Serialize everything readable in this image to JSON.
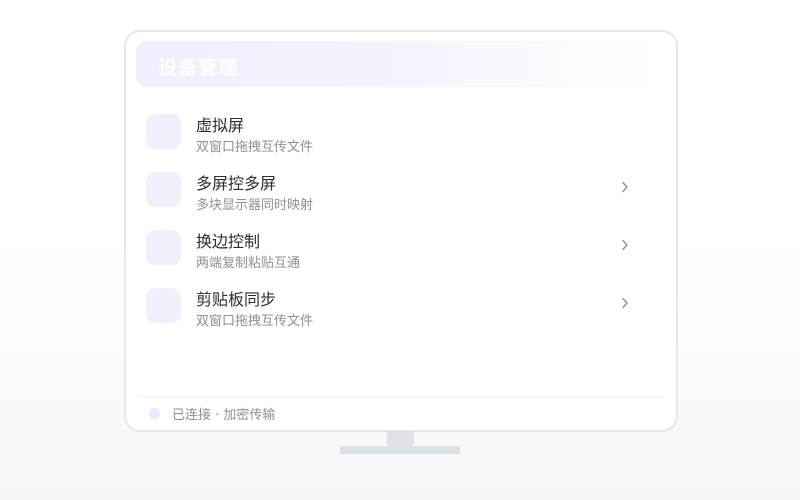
{
  "header": {
    "title": "设备管理"
  },
  "items": [
    {
      "title": "虚拟屏",
      "subtitle": "双窗口拖拽互传文件",
      "has_chevron": false
    },
    {
      "title": "多屏控多屏",
      "subtitle": "多块显示器同时映射",
      "has_chevron": true
    },
    {
      "title": "换边控制",
      "subtitle": "两端复制粘贴互通",
      "has_chevron": true
    },
    {
      "title": "剪贴板同步",
      "subtitle": "双窗口拖拽互传文件",
      "has_chevron": true
    }
  ],
  "footer": {
    "status": "已连接 · 加密传输"
  },
  "colors": {
    "accent_light": "#f2effd",
    "header_gradient_start": "#f1edfd",
    "text_primary": "#2b2d33",
    "text_secondary": "#8c8f97",
    "monitor_border": "#e6e7ea",
    "stand": "#dfe3e8"
  },
  "icons": {
    "chevron": "chevron-right-icon"
  }
}
